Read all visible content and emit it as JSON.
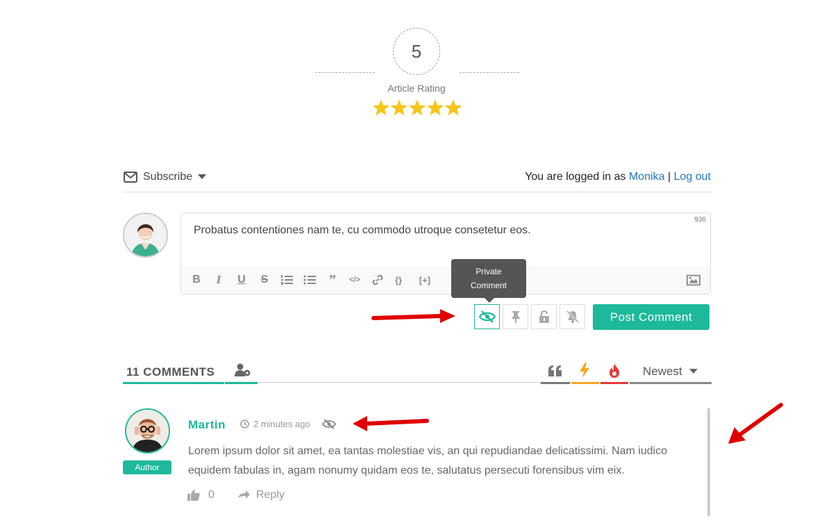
{
  "rating": {
    "value": "5",
    "label": "Article Rating",
    "stars": 5,
    "star_color": "#f5c518"
  },
  "subscribe": {
    "label": "Subscribe",
    "icon": "envelope-icon"
  },
  "login": {
    "prefix": "You are logged in as",
    "user": "Monika",
    "separator": "|",
    "logout": "Log out"
  },
  "editor": {
    "text": "Probatus contentiones nam te, cu commodo utroque consetetur eos.",
    "char_count": "936",
    "toolbar": [
      "bold",
      "italic",
      "underline",
      "strikethrough",
      "ordered-list",
      "unordered-list",
      "blockquote",
      "code",
      "link",
      "source-code",
      "spoiler",
      "image"
    ]
  },
  "tooltip": {
    "line1": "Private",
    "line2": "Comment"
  },
  "actions": {
    "post_comment": "Post Comment",
    "buttons": [
      "private-comment",
      "sticky",
      "close-thread",
      "disable-notification"
    ],
    "accent": "#1db99a"
  },
  "comments_header": {
    "count_label": "11 COMMENTS",
    "sort_label": "Newest",
    "tab_colors": [
      "#1db99a",
      "#f5a623",
      "#e53935"
    ]
  },
  "comment": {
    "author": "Martin",
    "time": "2 minutes ago",
    "badge": "Author",
    "body": "Lorem ipsum dolor sit amet, ea tantas molestiae vis, an qui repudiandae delicatissimi. Nam iudico equidem fabulas in, agam nonumy quidam eos te, salutatus persecuti forensibus vim eix.",
    "likes": "0",
    "reply": "Reply"
  },
  "annotations": {
    "arrow_color": "#e00000"
  }
}
